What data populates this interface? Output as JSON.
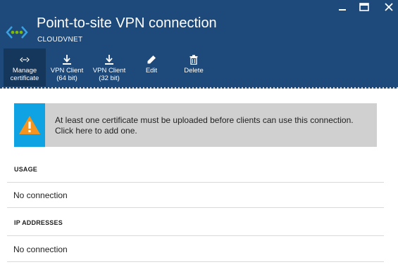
{
  "header": {
    "title": "Point-to-site VPN connection",
    "subtitle": "CLOUDVNET",
    "background": "#1d4a7a",
    "icon": "vpn-connection-icon"
  },
  "window_controls": {
    "minimize": "minimize-icon",
    "maximize": "maximize-icon",
    "close": "close-icon"
  },
  "toolbar": {
    "items": [
      {
        "label_1": "Manage",
        "label_2": "certificate",
        "icon": "certificate-icon",
        "active": true
      },
      {
        "label_1": "VPN Client",
        "label_2": "(64 bit)",
        "icon": "download-icon"
      },
      {
        "label_1": "VPN Client",
        "label_2": "(32 bit)",
        "icon": "download-icon"
      },
      {
        "label_1": "Edit",
        "label_2": "",
        "icon": "pencil-icon"
      },
      {
        "label_1": "Delete",
        "label_2": "",
        "icon": "trash-icon"
      }
    ]
  },
  "alert": {
    "message": "At least one certificate must be uploaded before clients can use this connection. Click here to add one.",
    "icon": "warning-icon",
    "icon_bg": "#0fa3e3",
    "warning_color": "#f7941d"
  },
  "sections": {
    "usage": {
      "heading": "USAGE",
      "value": "No connection"
    },
    "ip_addresses": {
      "heading": "IP ADDRESSES",
      "value": "No connection"
    }
  }
}
